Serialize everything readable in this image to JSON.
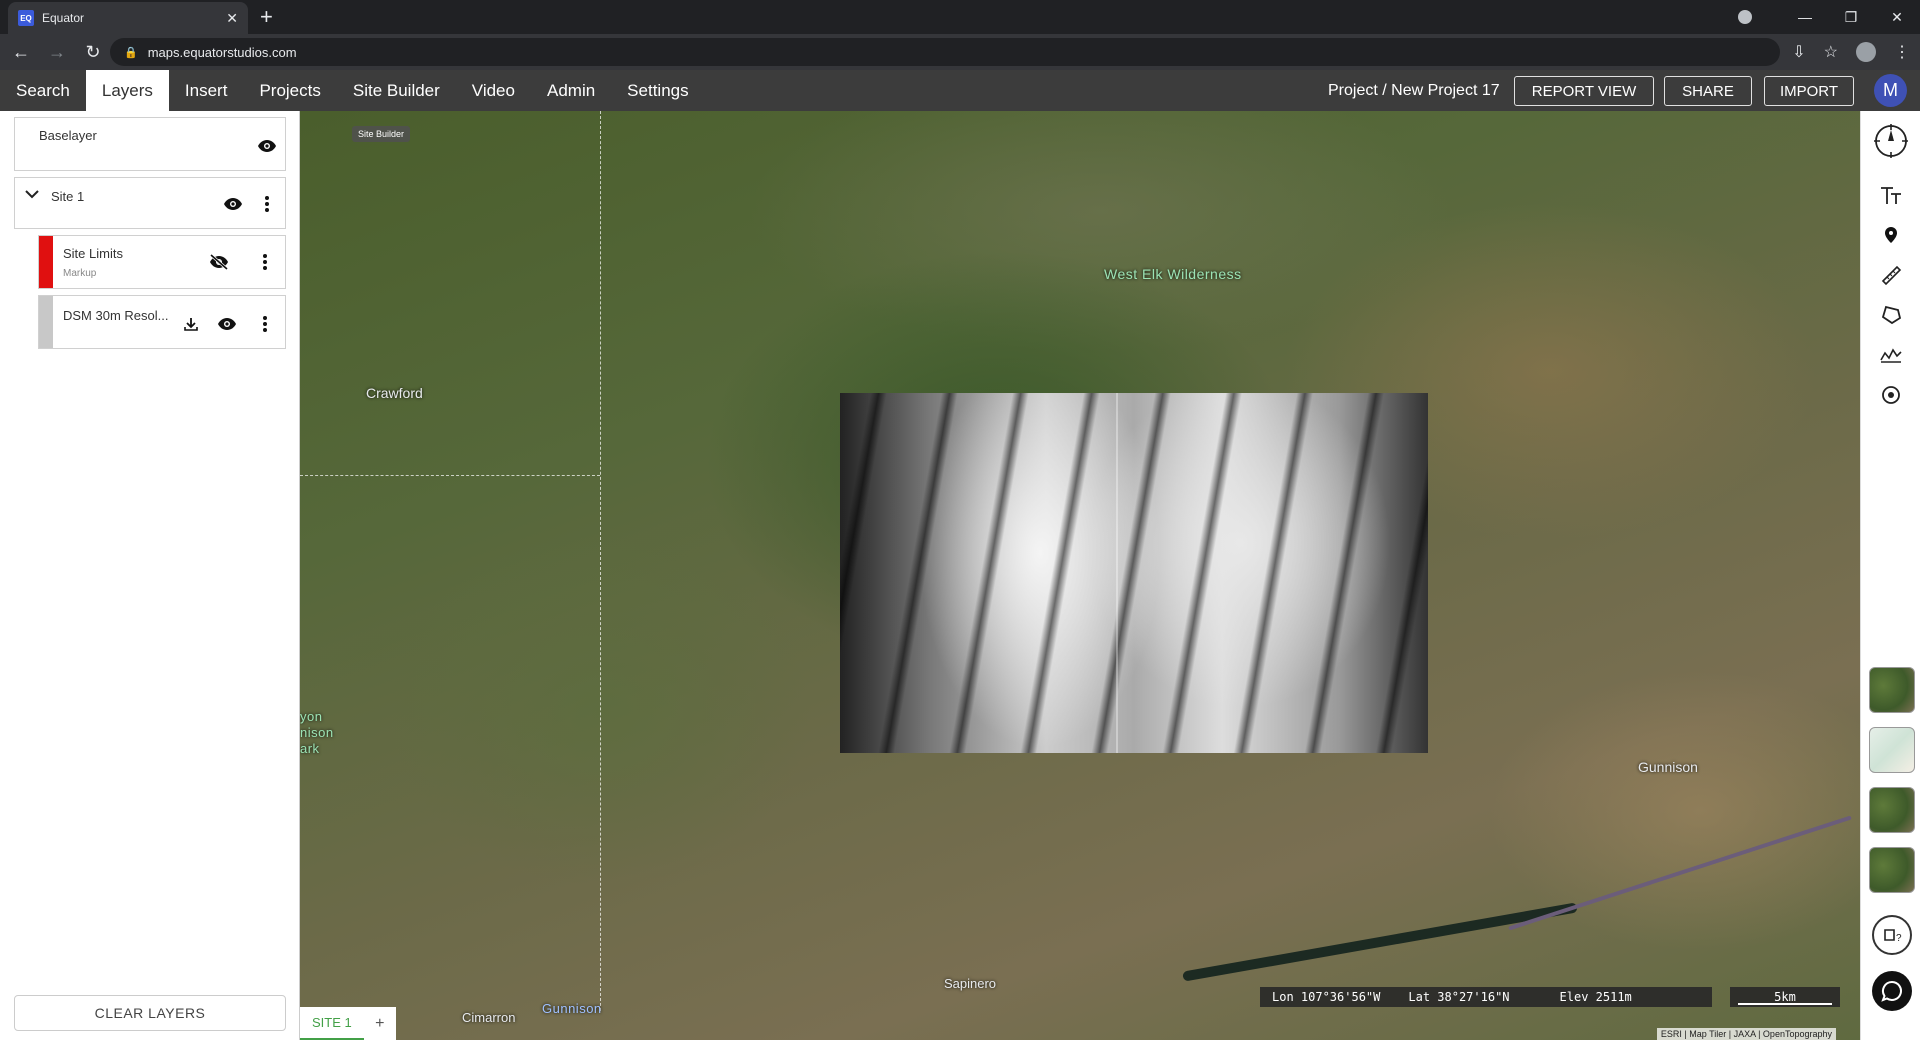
{
  "browser": {
    "tab_title": "Equator",
    "favicon_text": "EQ",
    "url": "maps.equatorstudios.com"
  },
  "appnav": {
    "items": [
      {
        "label": "Search"
      },
      {
        "label": "Layers",
        "active": true
      },
      {
        "label": "Insert"
      },
      {
        "label": "Projects"
      },
      {
        "label": "Site Builder"
      },
      {
        "label": "Video"
      },
      {
        "label": "Admin"
      },
      {
        "label": "Settings"
      }
    ],
    "project": "Project / New Project 17",
    "report_view": "REPORT VIEW",
    "share": "SHARE",
    "import": "IMPORT",
    "avatar_initial": "M",
    "avatar_color": "#3f51b5"
  },
  "layers": {
    "baselayer": {
      "title": "Baselayer"
    },
    "site": {
      "title": "Site 1"
    },
    "site_limits": {
      "title": "Site Limits",
      "subtitle": "Markup",
      "color": "#e01010",
      "visible": false
    },
    "dsm": {
      "title": "DSM 30m Resol...",
      "color": "#c8c8c8",
      "visible": true
    },
    "clear_button": "CLEAR LAYERS"
  },
  "map": {
    "chip": "Site Builder",
    "places": {
      "west_elk": "West Elk Wilderness",
      "crawford": "Crawford",
      "gunnison_city": "Gunnison",
      "sapinero": "Sapinero",
      "cimarron": "Cimarron",
      "gunnison_river": "Gunnison",
      "park_1": "yon",
      "park_2": "nison",
      "park_3": "ark"
    },
    "coords": {
      "lon": "Lon 107°36'56\"W",
      "lat": "Lat 38°27'16\"N",
      "elev": "Elev 2511m"
    },
    "scale": "5km",
    "attribution": "ESRI | Map Tiler | JAXA | OpenTopography",
    "site_tab": "SITE 1",
    "site_tab_add": "+"
  },
  "tools": {
    "compass": "compass-icon",
    "text": "text-icon",
    "pin": "pin-icon",
    "measure": "ruler-icon",
    "polygon": "polygon-icon",
    "profile": "profile-icon",
    "target": "target-icon"
  }
}
